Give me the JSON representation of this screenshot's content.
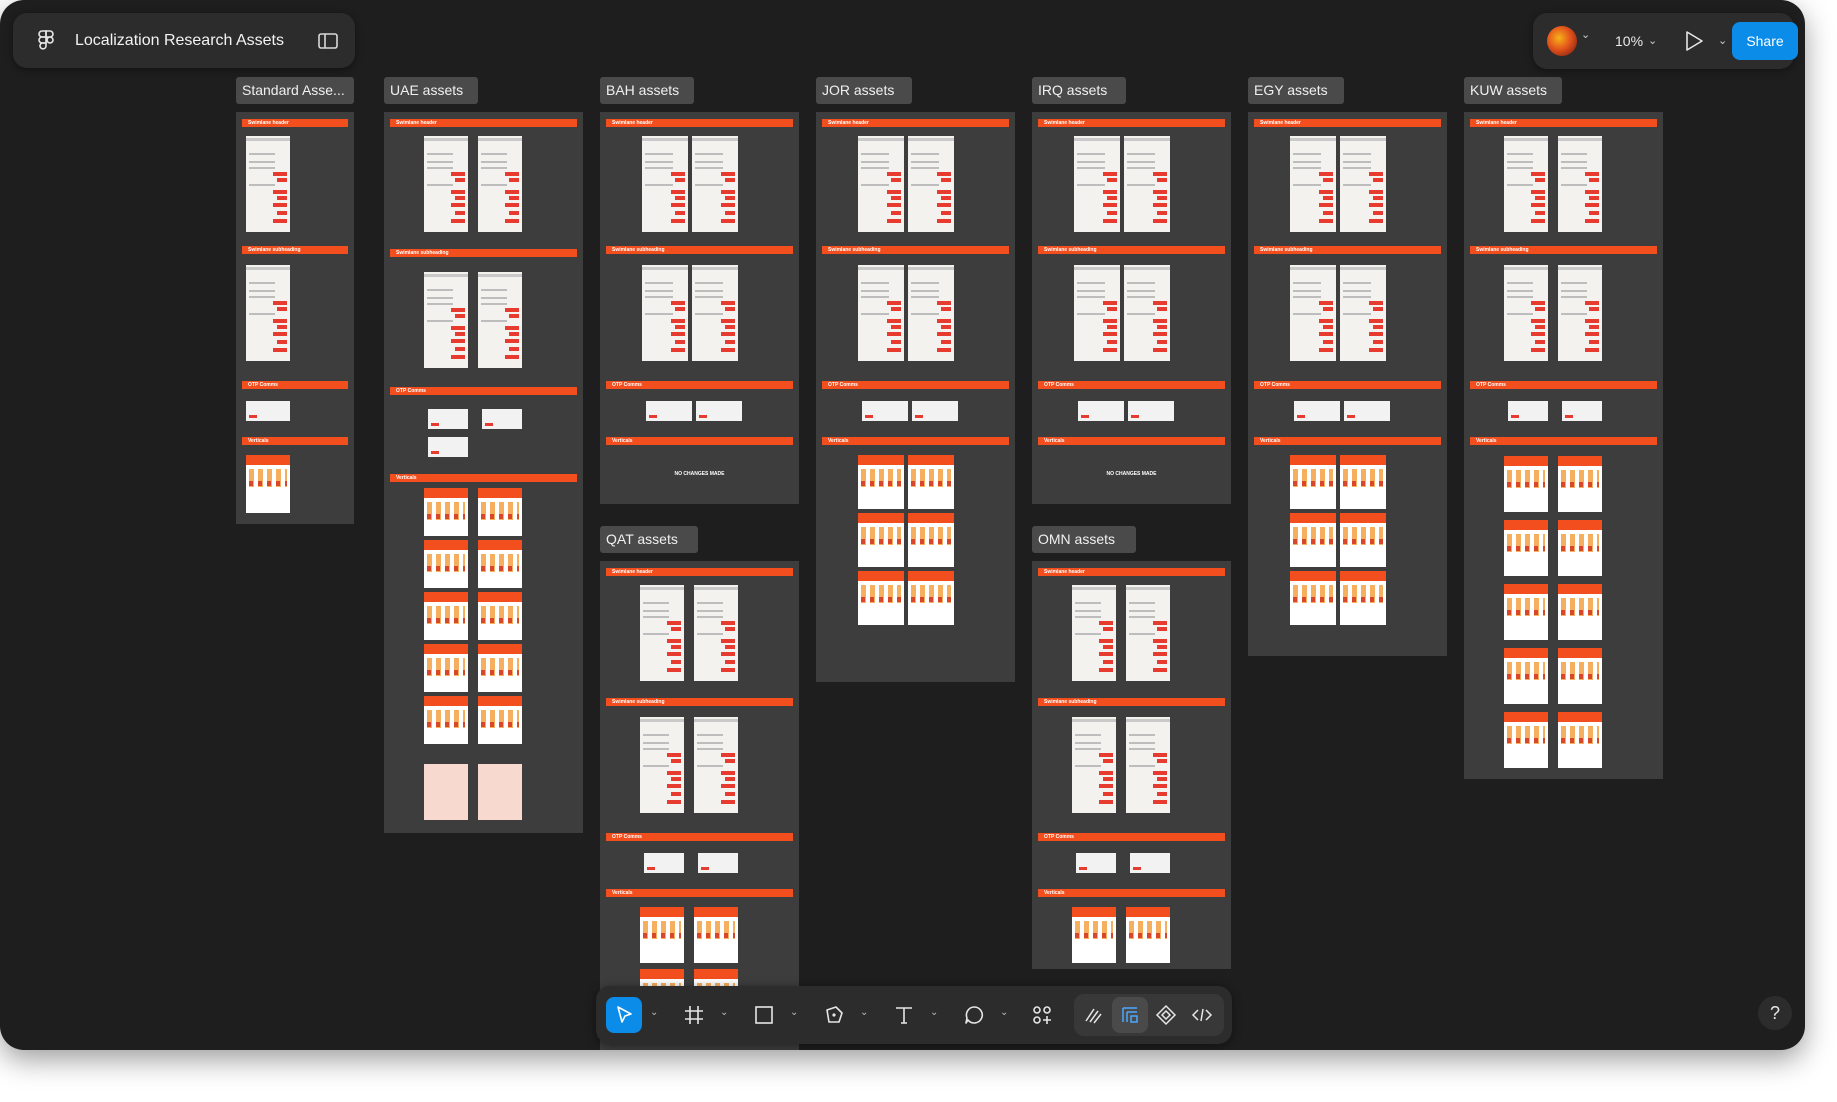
{
  "file": {
    "name": "Localization Research Assets"
  },
  "header": {
    "zoom": "10%",
    "share_label": "Share"
  },
  "frames": [
    {
      "title": "Standard Asse..."
    },
    {
      "title": "UAE assets"
    },
    {
      "title": "BAH assets"
    },
    {
      "title": "JOR assets"
    },
    {
      "title": "IRQ assets"
    },
    {
      "title": "EGY assets"
    },
    {
      "title": "KUW assets"
    },
    {
      "title": "QAT assets"
    },
    {
      "title": "OMN assets"
    }
  ],
  "sections": {
    "header": "Swimlane header",
    "subheading": "Swimlane subheading",
    "otp": "OTP Comms",
    "verticals": "Verticals",
    "no_changes": "NO CHANGES MADE"
  },
  "toolbar": {
    "tools": [
      "move-icon",
      "frame-icon",
      "rectangle-icon",
      "pen-icon",
      "text-icon",
      "comment-icon",
      "actions-icon"
    ],
    "modes": [
      "draw-icon",
      "design-icon",
      "component-icon",
      "dev-mode-icon"
    ]
  },
  "help": {
    "label": "?"
  },
  "colors": {
    "accent": "#0c8ce9",
    "canvas": "#1e1e1e",
    "section": "#f24e1e",
    "frame": "#3d3d3d"
  }
}
